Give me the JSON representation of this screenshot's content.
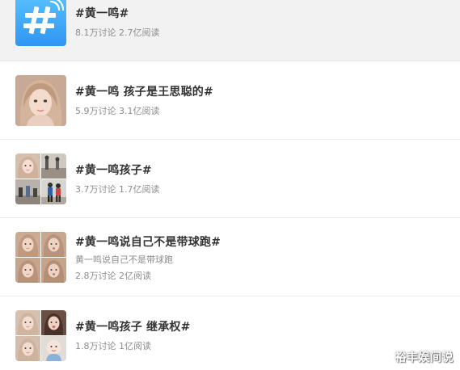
{
  "topics": [
    {
      "title": "#黄一鸣#",
      "meta": "8.1万讨论 2.7亿阅读",
      "thumb_icon": "hashtag-icon"
    },
    {
      "title": "#黄一鸣 孩子是王思聪的#",
      "meta": "5.9万讨论 3.1亿阅读",
      "thumb_icon": "person-photo"
    },
    {
      "title": "#黄一鸣孩子#",
      "meta": "3.7万讨论 1.7亿阅读",
      "thumb_icon": "photo-grid"
    },
    {
      "title": "#黄一鸣说自己不是带球跑#",
      "subtitle": "黄一鸣说自己不是带球跑",
      "meta": "2.8万讨论 2亿阅读",
      "thumb_icon": "photo-grid"
    },
    {
      "title": "#黄一鸣孩子 继承权#",
      "meta": "1.8万讨论 1亿阅读",
      "thumb_icon": "photo-grid"
    }
  ],
  "watermark": "裕丰娱间说",
  "colors": {
    "hashtag_blue": "#2e96f2",
    "title": "#333333",
    "meta": "#8c8c8c",
    "first_row_bg": "#f2f2f2"
  }
}
